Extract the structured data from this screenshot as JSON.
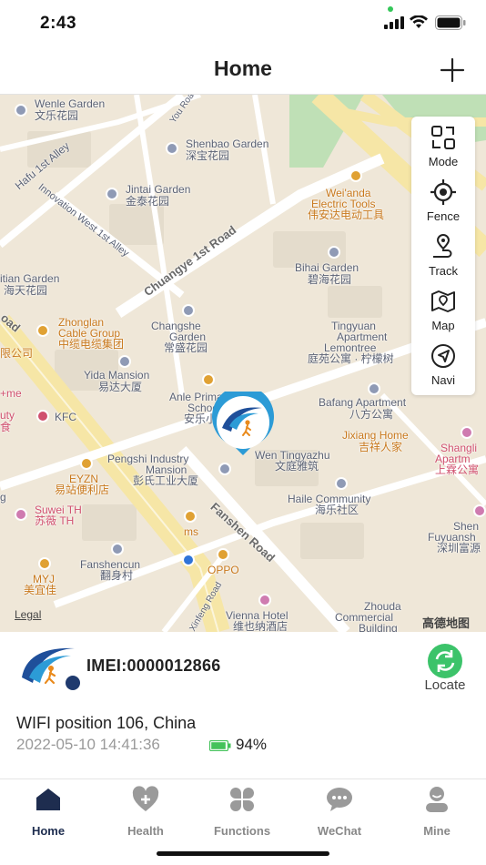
{
  "status": {
    "time": "2:43"
  },
  "nav": {
    "title": "Home"
  },
  "map": {
    "labels": {
      "wenle": "Wenle Garden",
      "wenle_cn": "文乐花园",
      "hafu": "Hafu 1st Alley",
      "shenbao": "Shenbao Garden",
      "shenbao_cn": "深宝花园",
      "jintai": "Jintai Garden",
      "jintai_cn": "金泰花园",
      "innovation": "Innovation West 1st Alley",
      "weianda": "Wei'anda",
      "electric": "Electric Tools",
      "weianda_cn": "伟安达电动工具",
      "chuangye": "Chuangye 1st Road",
      "bihai": "Bihai Garden",
      "bihai_cn": "碧海花园",
      "itian": "itian Garden",
      "haitian_cn": "海天花园",
      "oad": "oad",
      "zhonglan": "Zhonglan",
      "cable": "Cable Group",
      "zhonglan_cn": "中缆电缆集团",
      "gongsi": "限公司",
      "changsheng": "Changshe",
      "garden_frag": "Garden",
      "changsheng_cn": "常盛花园",
      "tingyuan": "Tingyuan",
      "apartment": "Apartment",
      "lemontree": "Lemontree",
      "tingyuan_cn": "庭苑公寓 · 柠檬树",
      "yida": "Yida Mansion",
      "yida_cn": "易达大厦",
      "anle": "Anle Primary",
      "school": "School",
      "anle_cn": "安乐小学",
      "plusme": "+me",
      "uty": "uty",
      "kfc_frag": "食",
      "kfc": "KFC",
      "bafang": "Bafang Apartment",
      "bafang_cn": "八方公寓",
      "jixiang": "Jixiang Home",
      "jixiang_cn": "吉祥人家",
      "pengshi": "Pengshi Industry",
      "mansion": "Mansion",
      "pengshi_cn": "彭氏工业大厦",
      "wen": "Wen Tingyazhu",
      "wen_cn": "文庭雅筑",
      "shangli": "Shangli",
      "apartm": "Apartm",
      "shangli_cn": "上霖公寓",
      "eyzn": "EYZN",
      "eyzn_cn": "易站便利店",
      "haile": "Haile Community",
      "haile_cn": "海乐社区",
      "suwei": "Suwei TH",
      "suwei_cn": "苏薇 TH",
      "ms": "ms",
      "fanshen": "Fanshen Road",
      "shen": "Shen",
      "fuyuansh": "Fuyuansh",
      "shenzhen_cn": "深圳富源",
      "fanshencun": "Fanshencun",
      "fanshencun_cn": "翻身村",
      "oppo": "OPPO",
      "myj": "MYJ",
      "myj_cn": "美宜佳",
      "zhouda": "Zhouda",
      "commercial": "Commercial",
      "building": "Building",
      "vienna": "Vienna Hotel",
      "vienna_cn": "维也纳酒店",
      "xinfeng": "Xinfeng Road",
      "g": "g",
      "you": "You Road"
    },
    "legal": "Legal",
    "brand": "高德地图"
  },
  "tools": [
    {
      "label": "Mode",
      "icon": "mode-icon"
    },
    {
      "label": "Fence",
      "icon": "fence-icon"
    },
    {
      "label": "Track",
      "icon": "track-icon"
    },
    {
      "label": "Map",
      "icon": "map-icon"
    },
    {
      "label": "Navi",
      "icon": "navi-icon"
    }
  ],
  "device": {
    "imei": "IMEI:0000012866",
    "locate_label": "Locate",
    "position": "WIFI position  106, China",
    "timestamp": "2022-05-10 14:41:36",
    "battery": "94%",
    "battery_level": 0.94
  },
  "tabs": [
    {
      "label": "Home",
      "icon": "home-icon",
      "active": true
    },
    {
      "label": "Health",
      "icon": "health-icon",
      "active": false
    },
    {
      "label": "Functions",
      "icon": "functions-icon",
      "active": false
    },
    {
      "label": "WeChat",
      "icon": "wechat-icon",
      "active": false
    },
    {
      "label": "Mine",
      "icon": "mine-icon",
      "active": false
    }
  ],
  "colors": {
    "accent_green": "#3cc36a",
    "battery_green": "#44c25a",
    "tab_active": "#1e2d4f",
    "tab_inactive": "#9a9a9a",
    "marker_blue": "#2c9bd6"
  }
}
